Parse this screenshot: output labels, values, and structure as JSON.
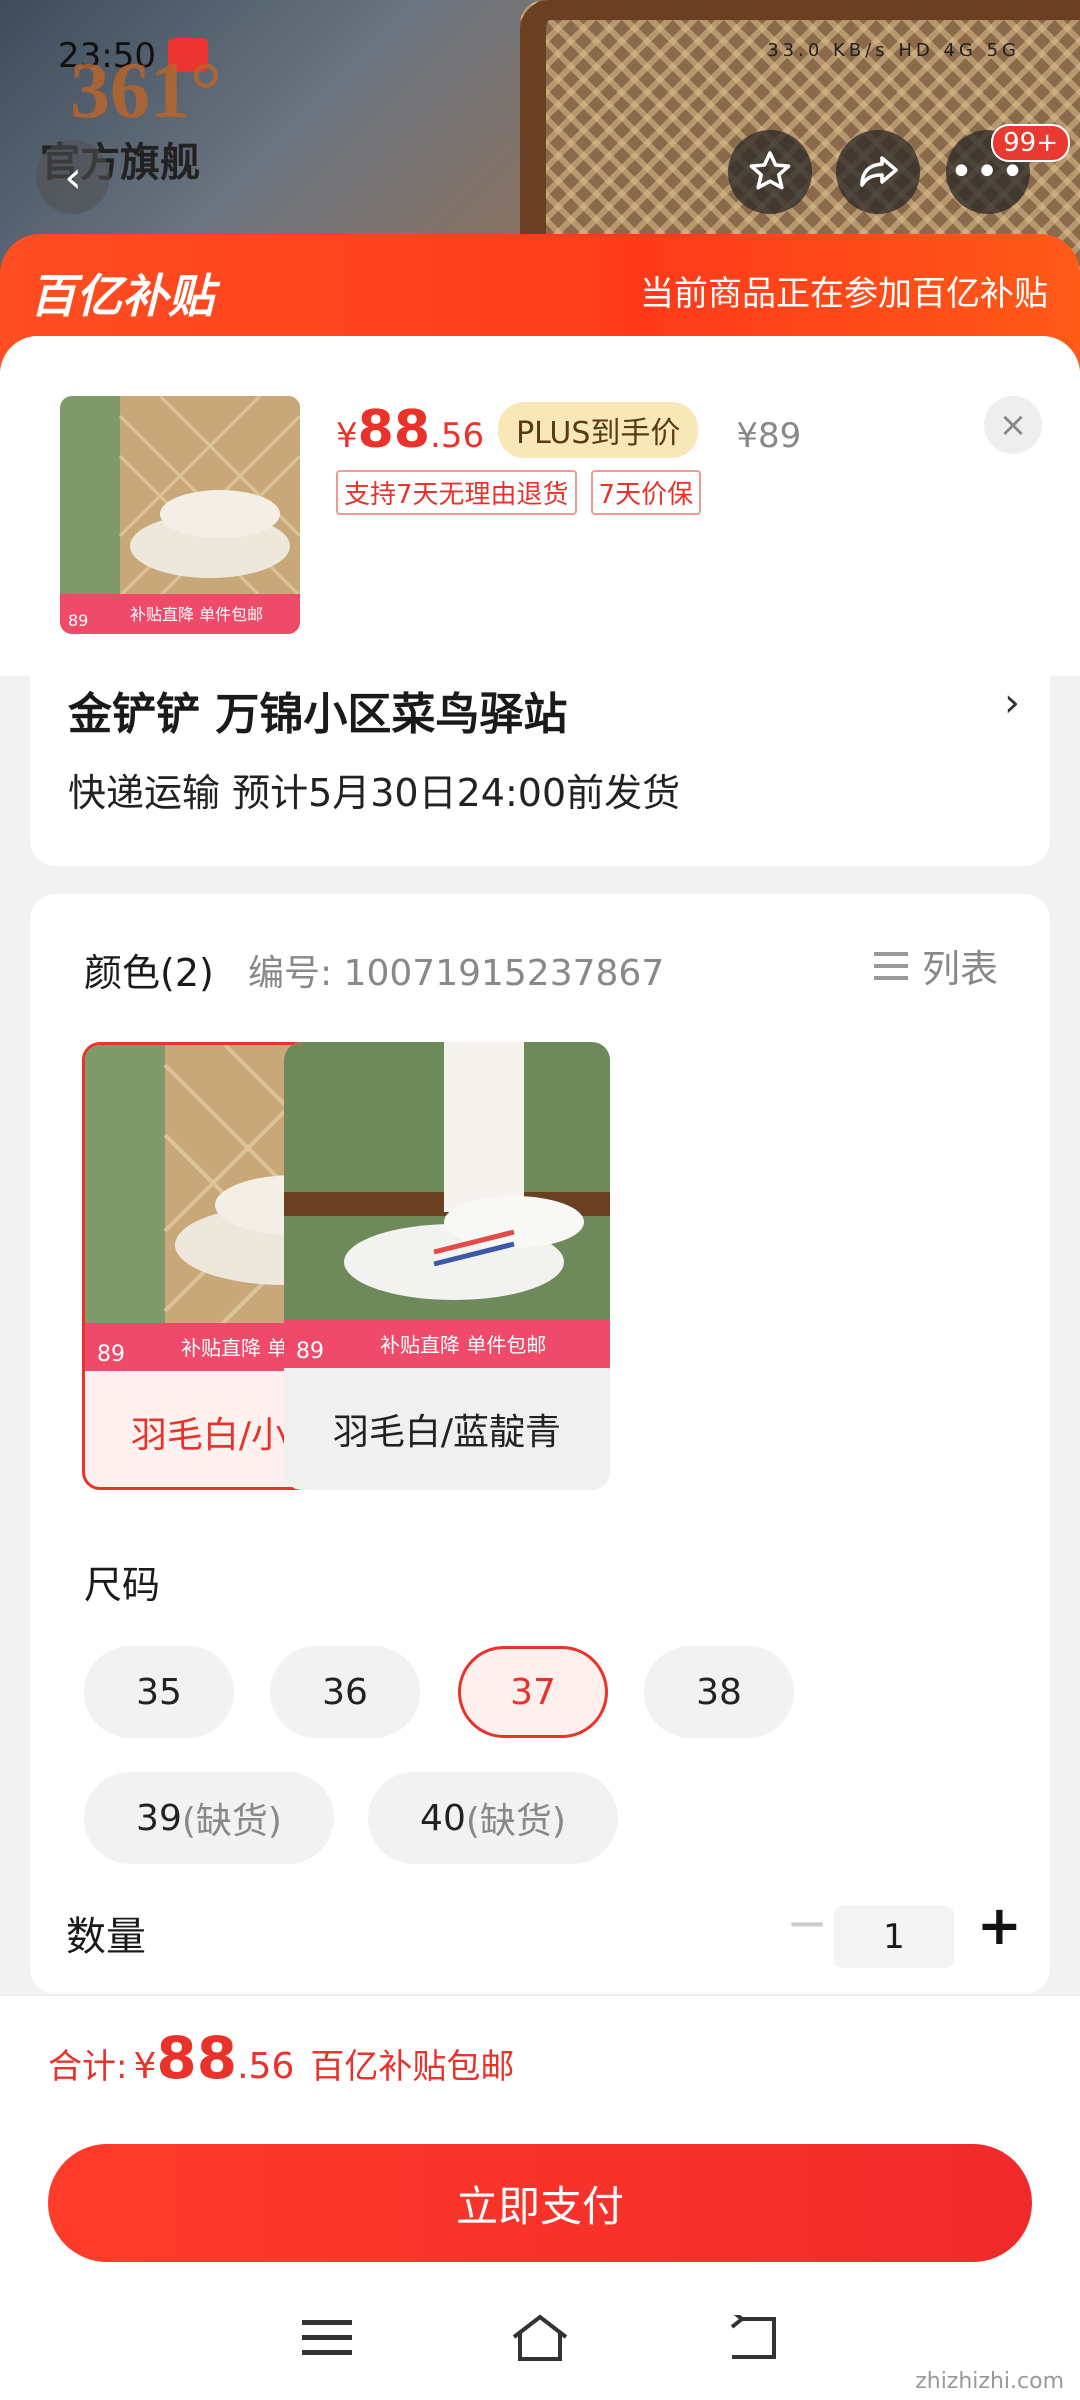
{
  "status": {
    "time": "23:50",
    "right": "33.0 KB/s  HD 4G 5G"
  },
  "store": {
    "brand": "361°",
    "subtitle": "官方旗舰"
  },
  "header": {
    "badge": "99+"
  },
  "banner": {
    "logo": "百亿补贴",
    "text": "当前商品正在参加百亿补贴"
  },
  "product": {
    "price_currency": "¥",
    "price_int": "88",
    "price_dec": ".56",
    "plus_tag": "PLUS到手价",
    "original_price": "¥89",
    "tags": [
      "支持7天无理由退货",
      "7天价保"
    ]
  },
  "address": {
    "main": "金铲铲  万锦小区菜鸟驿站",
    "delivery": "快递运输  预计5月30日24:00前发货"
  },
  "spec": {
    "color_title": "颜色(2)",
    "code": "编号: 10071915237867",
    "list_label": "列表",
    "colors": [
      {
        "name": "羽毛白/小麦褐",
        "selected": true
      },
      {
        "name": "羽毛白/蓝靛青",
        "selected": false
      }
    ],
    "size_title": "尺码",
    "sizes": [
      {
        "value": "35",
        "oos": ""
      },
      {
        "value": "36",
        "oos": ""
      },
      {
        "value": "37",
        "oos": "",
        "selected": true
      },
      {
        "value": "38",
        "oos": ""
      },
      {
        "value": "39",
        "oos": "(缺货)"
      },
      {
        "value": "40",
        "oos": "(缺货)"
      }
    ],
    "qty_title": "数量",
    "qty": "1",
    "minus": "−",
    "plus": "+"
  },
  "footer": {
    "total_label": "合计:",
    "total_currency": "¥",
    "total_int": "88",
    "total_dec": ".56",
    "total_note": "百亿补贴包邮",
    "pay": "立即支付"
  },
  "watermark": "zhizhizhi.com",
  "colors": {
    "accent": "#e8322a",
    "banner": "#ff4e22",
    "plus_bg": "#f8e8b8"
  }
}
